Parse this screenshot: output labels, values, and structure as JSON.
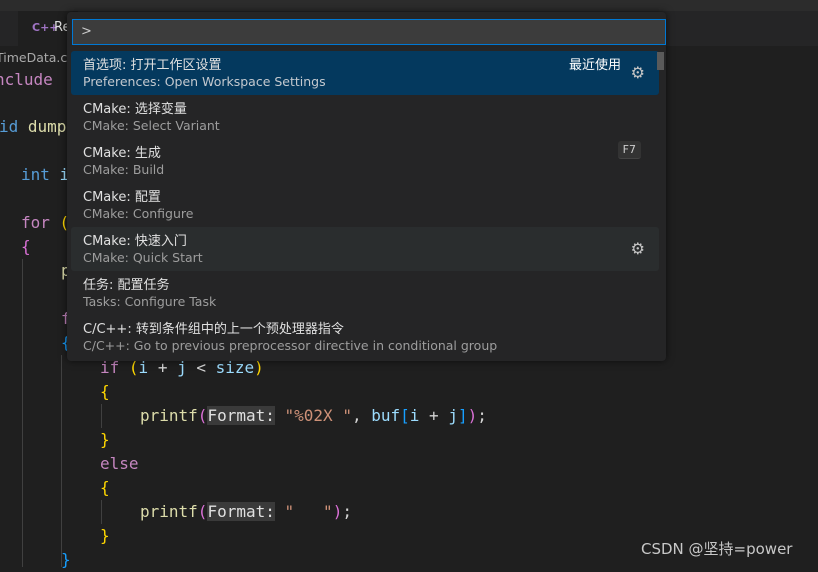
{
  "tab": {
    "icon": "cpp-file-icon",
    "label": "Re"
  },
  "breadcrumb": "TimeData.cp",
  "colors": {
    "keyword": "#c586c0",
    "type": "#569cd6",
    "func": "#dcdcaa",
    "var": "#9cdcfe",
    "string": "#ce9178",
    "brace": "#ffd700",
    "paren": "#da70d6",
    "bracket": "#179fff",
    "plain": "#d4d4d4",
    "accent": "#0078d4",
    "selected": "#04395e"
  },
  "code": [
    [
      [
        "nclude",
        "keyword"
      ]
    ],
    [
      [
        "id ",
        "type"
      ],
      [
        "dump",
        "func"
      ]
    ],
    [
      [
        "int ",
        "type"
      ],
      [
        "i",
        "var"
      ]
    ],
    [
      [
        "for ",
        "keyword"
      ],
      [
        "(",
        "brace"
      ]
    ],
    [
      [
        "{",
        "paren"
      ]
    ],
    [
      [
        "p",
        "func"
      ]
    ],
    [
      [
        "f",
        "keyword"
      ]
    ],
    [
      [
        "{",
        "bracket"
      ]
    ],
    [
      [
        "if ",
        "keyword"
      ],
      [
        "(",
        "brace"
      ],
      [
        "i",
        "var"
      ],
      [
        " + ",
        "plain"
      ],
      [
        "j",
        "var"
      ],
      [
        " < ",
        "plain"
      ],
      [
        "size",
        "var"
      ],
      [
        ")",
        "brace"
      ]
    ],
    [
      [
        "{",
        "brace"
      ]
    ],
    [
      [
        "printf",
        "func"
      ],
      [
        "(",
        "paren"
      ],
      [
        "Format:",
        "hint"
      ],
      [
        " ",
        "plain"
      ],
      [
        "\"%02X \"",
        "string"
      ],
      [
        ", ",
        "plain"
      ],
      [
        "buf",
        "var"
      ],
      [
        "[",
        "bracket"
      ],
      [
        "i",
        "var"
      ],
      [
        " + ",
        "plain"
      ],
      [
        "j",
        "var"
      ],
      [
        "]",
        "bracket"
      ],
      [
        ")",
        "paren"
      ],
      [
        ";",
        "plain"
      ]
    ],
    [
      [
        "}",
        "brace"
      ]
    ],
    [
      [
        "else",
        "keyword"
      ]
    ],
    [
      [
        "{",
        "brace"
      ]
    ],
    [
      [
        "printf",
        "func"
      ],
      [
        "(",
        "paren"
      ],
      [
        "Format:",
        "hint"
      ],
      [
        " ",
        "plain"
      ],
      [
        "\"   \"",
        "string"
      ],
      [
        ")",
        "paren"
      ],
      [
        ";",
        "plain"
      ]
    ],
    [
      [
        "}",
        "brace"
      ]
    ],
    [
      [
        "}",
        "bracket"
      ]
    ]
  ],
  "palette": {
    "input_value": ">",
    "items": [
      {
        "title": "首选项: 打开工作区设置",
        "subtitle": "Preferences: Open Workspace Settings",
        "badge": "最近使用",
        "gear": true,
        "state": "selected"
      },
      {
        "title": "CMake: 选择变量",
        "subtitle": "CMake: Select Variant"
      },
      {
        "title": "CMake: 生成",
        "subtitle": "CMake: Build",
        "keybinding": "F7"
      },
      {
        "title": "CMake: 配置",
        "subtitle": "CMake: Configure"
      },
      {
        "title": "CMake: 快速入门",
        "subtitle": "CMake: Quick Start",
        "gear": true,
        "state": "hover"
      },
      {
        "title": "任务: 配置任务",
        "subtitle": "Tasks: Configure Task"
      },
      {
        "title": "C/C++: 转到条件组中的上一个预处理器指令",
        "subtitle": "C/C++: Go to previous preprocessor directive in conditional group"
      }
    ]
  },
  "watermark": "CSDN @坚持=power"
}
